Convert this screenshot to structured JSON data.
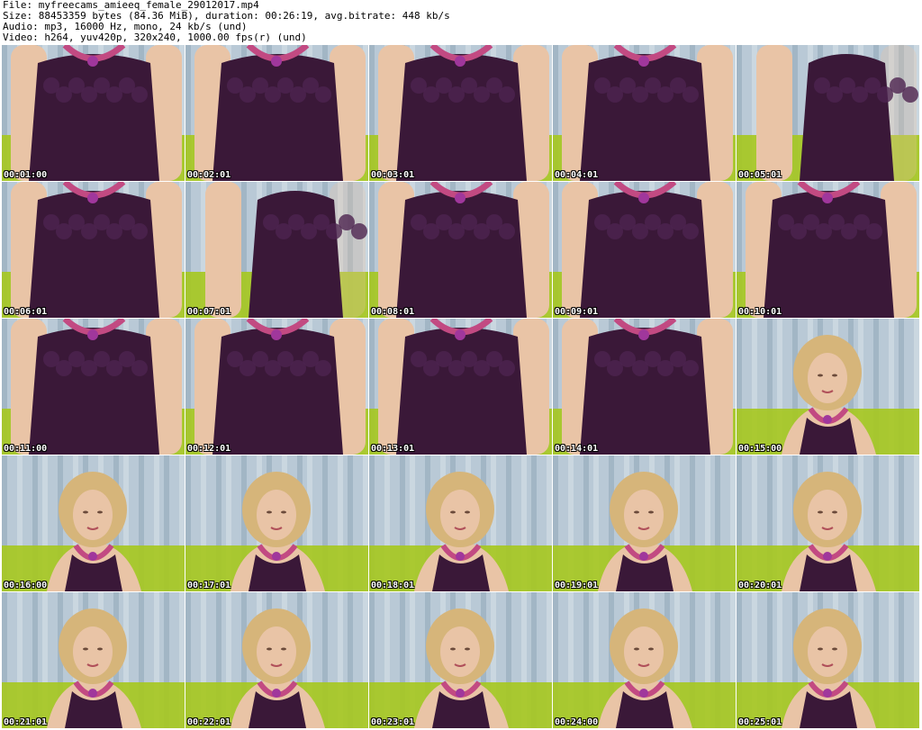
{
  "header": {
    "file": "File: myfreecams_amieeq_female_29012017.mp4",
    "size": "Size: 88453359 bytes (84.36 MiB), duration: 00:26:19, avg.bitrate: 448 kb/s",
    "audio": "Audio: mp3, 16000 Hz, mono, 24 kb/s (und)",
    "video": "Video: h264, yuv420p, 320x240, 1000.00 fps(r) (und)"
  },
  "colors": {
    "dress": "#3a1838",
    "skin": "#e9c4a6",
    "hair": "#d6b57a",
    "curtain": "#b9c9d6",
    "cushion": "#a6c81e",
    "necklace": "#c24a82"
  },
  "thumbnails": [
    {
      "time": "00:01:00",
      "scene": "torso"
    },
    {
      "time": "00:02:01",
      "scene": "torso"
    },
    {
      "time": "00:03:01",
      "scene": "torso"
    },
    {
      "time": "00:04:01",
      "scene": "torso"
    },
    {
      "time": "00:05:01",
      "scene": "torso-side"
    },
    {
      "time": "00:06:01",
      "scene": "torso"
    },
    {
      "time": "00:07:01",
      "scene": "torso-side"
    },
    {
      "time": "00:08:01",
      "scene": "torso"
    },
    {
      "time": "00:09:01",
      "scene": "torso"
    },
    {
      "time": "00:10:01",
      "scene": "torso"
    },
    {
      "time": "00:11:00",
      "scene": "torso"
    },
    {
      "time": "00:12:01",
      "scene": "torso"
    },
    {
      "time": "00:13:01",
      "scene": "torso"
    },
    {
      "time": "00:14:01",
      "scene": "torso"
    },
    {
      "time": "00:15:00",
      "scene": "face"
    },
    {
      "time": "00:16:00",
      "scene": "face"
    },
    {
      "time": "00:17:01",
      "scene": "face"
    },
    {
      "time": "00:18:01",
      "scene": "face"
    },
    {
      "time": "00:19:01",
      "scene": "face"
    },
    {
      "time": "00:20:01",
      "scene": "face"
    },
    {
      "time": "00:21:01",
      "scene": "face"
    },
    {
      "time": "00:22:01",
      "scene": "face"
    },
    {
      "time": "00:23:01",
      "scene": "face"
    },
    {
      "time": "00:24:00",
      "scene": "face"
    },
    {
      "time": "00:25:01",
      "scene": "face"
    }
  ]
}
